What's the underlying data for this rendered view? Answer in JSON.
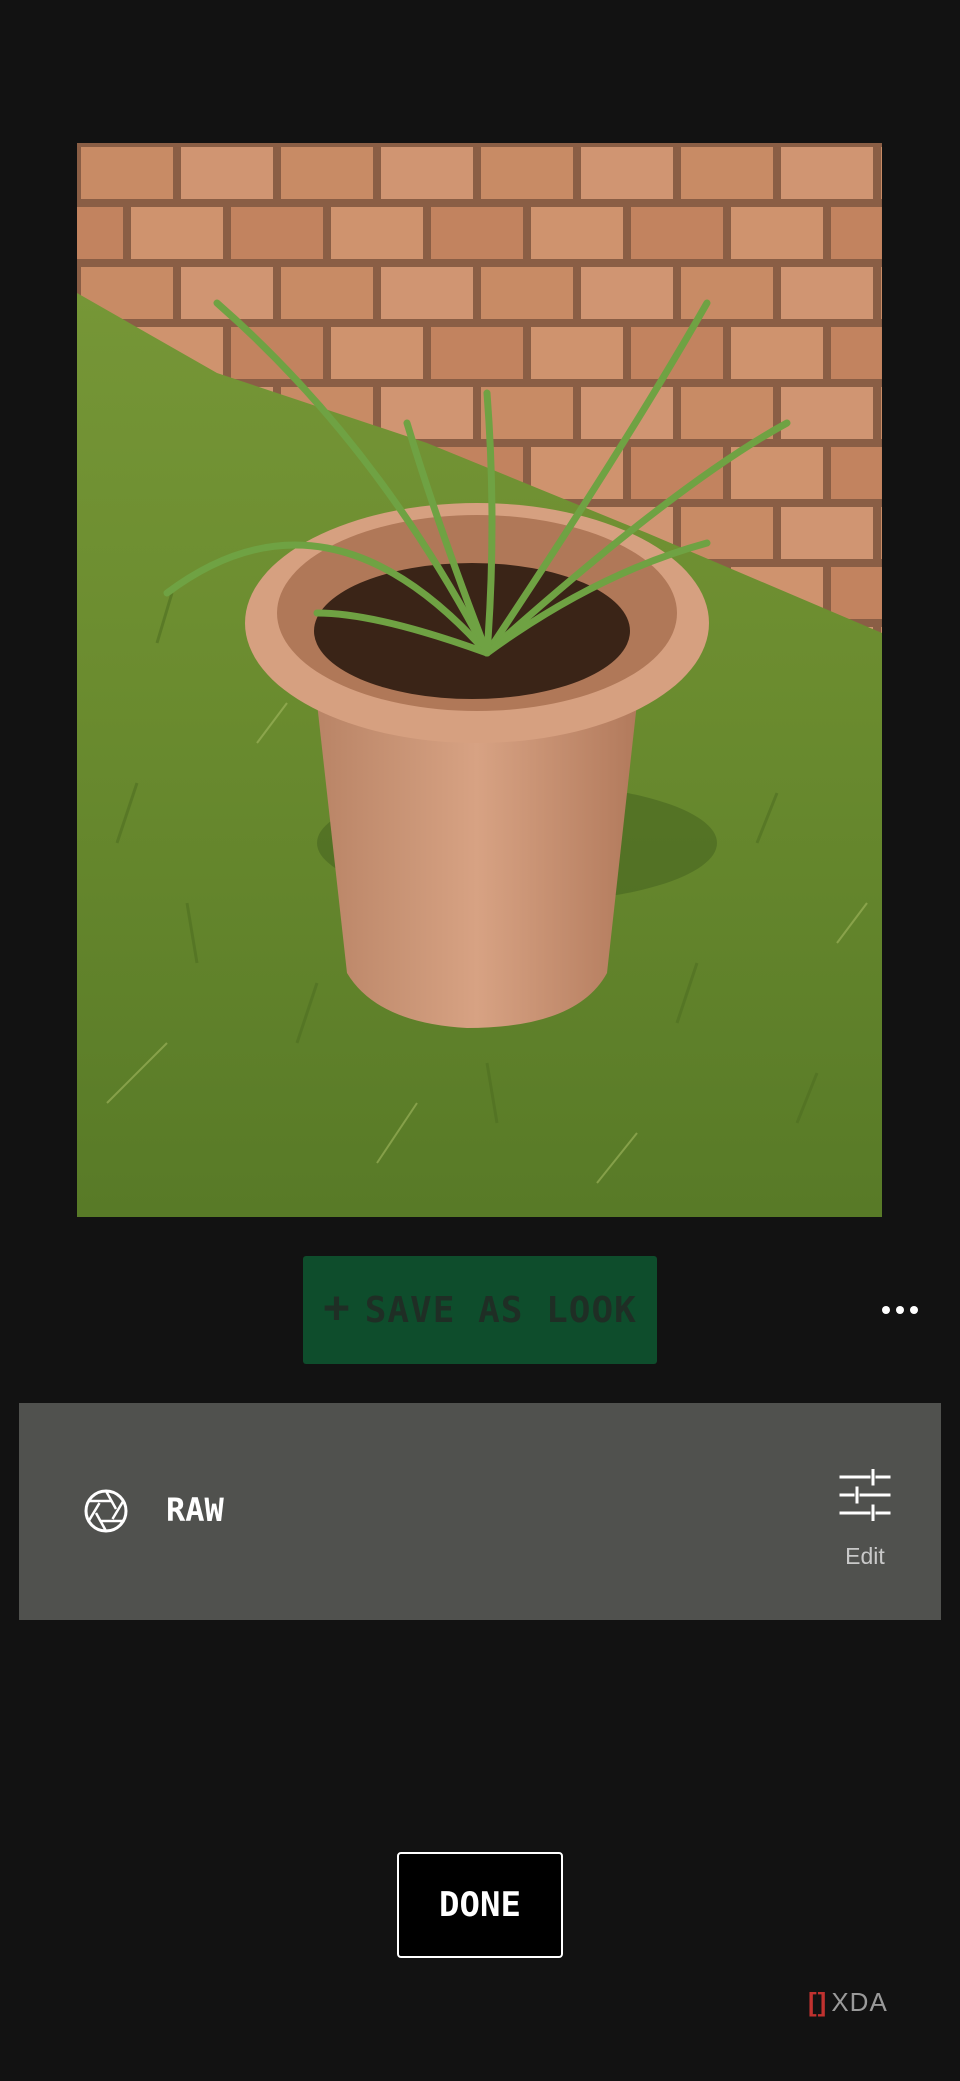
{
  "photo": {
    "subject": "potted-plant-photo"
  },
  "toolbar": {
    "save_look_label": "SAVE AS LOOK",
    "save_look_icon": "plus-icon",
    "more_icon": "more-horizontal-icon"
  },
  "look": {
    "icon": "aperture-icon",
    "name": "RAW",
    "edit_icon": "sliders-icon",
    "edit_label": "Edit"
  },
  "footer": {
    "done_label": "DONE"
  },
  "watermark": {
    "text": "XDA",
    "bracket": "[]"
  },
  "colors": {
    "background": "#121212",
    "save_look_bg": "#0e4d2c",
    "save_look_text": "#1f2e25",
    "panel_bg": "#50514e",
    "done_bg": "#000000",
    "watermark_red": "#c0322f"
  }
}
